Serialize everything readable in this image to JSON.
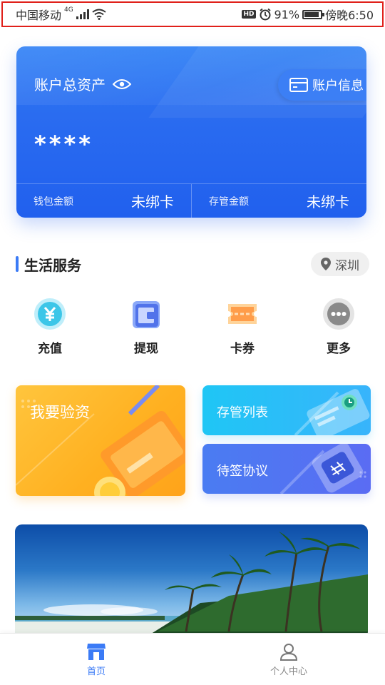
{
  "status_bar": {
    "carrier": "中国移动",
    "network": "4G",
    "battery": "91%",
    "battery_level": 0.91,
    "time": "傍晚6:50",
    "hd": "HD"
  },
  "asset_card": {
    "title": "账户总资产",
    "account_info": "账户信息",
    "amount": "****",
    "wallet_label": "钱包金额",
    "wallet_value": "未绑卡",
    "custody_label": "存管金额",
    "custody_value": "未绑卡"
  },
  "life_service": {
    "title": "生活服务",
    "city": "深圳",
    "items": [
      {
        "label": "充值",
        "icon": "yuan-coin-icon"
      },
      {
        "label": "提现",
        "icon": "wallet-icon"
      },
      {
        "label": "卡券",
        "icon": "coupon-icon"
      },
      {
        "label": "更多",
        "icon": "more-icon"
      }
    ]
  },
  "promos": {
    "verify_funds": "我要验资",
    "custody_list": "存管列表",
    "pending_agreements": "待签协议"
  },
  "bottom_nav": {
    "home": "首页",
    "profile": "个人中心"
  },
  "colors": {
    "primary": "#3b7bf6",
    "card_blue": "#2a6cf0",
    "promo_yellow": "#ffb020",
    "promo_cyan": "#1fc6f5",
    "promo_indigo": "#4a7cf2",
    "status_border": "#e0201a"
  }
}
